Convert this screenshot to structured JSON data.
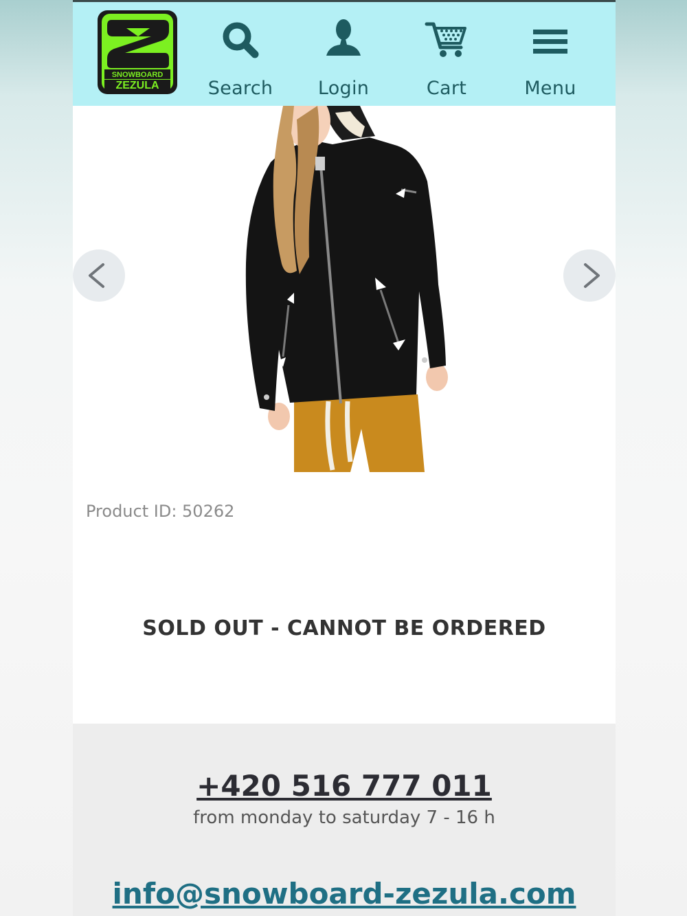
{
  "header": {
    "logo": {
      "line1": "SNOWBOARD",
      "line2": "ZEZULA",
      "icon": "snowboard-zezula-logo",
      "color": "#7cf021"
    },
    "background": "#b4f0f5",
    "nav": [
      {
        "label": "Search",
        "icon": "search-icon"
      },
      {
        "label": "Login",
        "icon": "user-icon"
      },
      {
        "label": "Cart",
        "icon": "cart-icon"
      },
      {
        "label": "Menu",
        "icon": "hamburger-menu-icon"
      }
    ]
  },
  "carousel": {
    "prev_icon": "chevron-left-icon",
    "next_icon": "chevron-right-icon"
  },
  "product": {
    "id_text": "Product ID: 50262",
    "status": "SOLD OUT - CANNOT BE ORDERED"
  },
  "footer": {
    "phone": "+420 516 777 011",
    "hours": "from monday to saturday 7 - 16 h",
    "email": "info@snowboard-zezula.com"
  }
}
